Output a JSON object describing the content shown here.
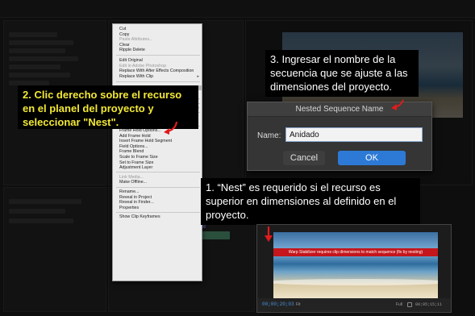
{
  "context_menu": {
    "items": [
      {
        "label": "Cut",
        "disabled": false
      },
      {
        "label": "Copy",
        "disabled": false
      },
      {
        "label": "Paste Attributes...",
        "disabled": true
      },
      {
        "label": "Clear",
        "disabled": false
      },
      {
        "label": "Ripple Delete",
        "disabled": false
      },
      {
        "label": "Edit Original",
        "disabled": false
      },
      {
        "label": "Edit in Adobe Photoshop",
        "disabled": true
      },
      {
        "label": "Replace With After Effects Composition",
        "disabled": false
      },
      {
        "label": "Replace With Clip",
        "disabled": false
      },
      {
        "label": "Nest...",
        "disabled": false,
        "highlighted": true
      },
      {
        "label": "Make Subsequence",
        "disabled": false
      },
      {
        "label": "Multi-Camera",
        "disabled": true
      },
      {
        "label": "Label",
        "disabled": false
      },
      {
        "label": "Speed/Duration...",
        "disabled": false
      },
      {
        "label": "Remove Effects...",
        "disabled": false
      },
      {
        "label": "Frame Hold Options...",
        "disabled": false
      },
      {
        "label": "Add Frame Hold",
        "disabled": false
      },
      {
        "label": "Insert Frame Hold Segment",
        "disabled": false
      },
      {
        "label": "Field Options...",
        "disabled": false
      },
      {
        "label": "Frame Blend",
        "disabled": false
      },
      {
        "label": "Scale to Frame Size",
        "disabled": false
      },
      {
        "label": "Set to Frame Size",
        "disabled": false
      },
      {
        "label": "Adjustment Layer",
        "disabled": false
      },
      {
        "label": "Link Media...",
        "disabled": true
      },
      {
        "label": "Make Offline...",
        "disabled": false
      },
      {
        "label": "Rename...",
        "disabled": false
      },
      {
        "label": "Reveal in Project",
        "disabled": false
      },
      {
        "label": "Reveal in Finder...",
        "disabled": false
      },
      {
        "label": "Properties",
        "disabled": false
      },
      {
        "label": "Show Clip Keyframes",
        "disabled": false
      }
    ]
  },
  "callouts": {
    "step2": "2. Clic derecho sobre el recurso en el planel del proyecto y seleccionar \"Nest\".",
    "step3": "3. Ingresar el nombre de la secuencia que se ajuste a las dimensiones del proyecto.",
    "step1": "1. “Nest” es requerido si el recurso es superior en dimensiones al definido en el proyecto."
  },
  "dialog": {
    "title": "Nested Sequence Name",
    "name_label": "Name:",
    "name_value": "Anidado",
    "cancel_label": "Cancel",
    "ok_label": "OK"
  },
  "monitor": {
    "warning": "Warp Stabilizer requires clip dimensions to match sequence (fix by nesting)",
    "timecode": "00;00;20;03",
    "zoom": "Fit",
    "quality": "Full",
    "duration": "00;05;15;11"
  },
  "colors": {
    "callout_yellow": "#f2e836",
    "arrow_red": "#e01b1b",
    "ok_blue": "#2d7ad6",
    "warning_red": "#c4161c"
  }
}
